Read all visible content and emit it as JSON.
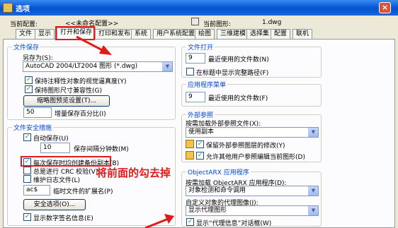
{
  "window": {
    "title": "选项",
    "close_glyph": "×"
  },
  "profile": {
    "current_profile_label": "当前配置:",
    "current_profile_value": "<<未命名配置>>",
    "current_drawing_label": "当前图形:",
    "current_drawing_value": "1.dwg"
  },
  "tabs": [
    "文件",
    "显示",
    "打开和保存",
    "打印和发布",
    "系统",
    "用户系统配置",
    "绘图",
    "三维建模",
    "选择集",
    "配置",
    "联机"
  ],
  "active_tab": "打开和保存",
  "file_save": {
    "title": "文件保存",
    "save_as_label": "另存为(S):",
    "save_as_value": "AutoCAD 2004/LT2004 图形 (*.dwg)",
    "keep_visual_fidelity": "保持注释性对象的视觉逼真度(Y)",
    "keep_drawing_size": "保持图形尺寸兼容性(G)",
    "thumbnail_button": "缩略图预览设置(T)...",
    "incremental_value": "50",
    "incremental_label": "增量保存百分比(I)"
  },
  "file_safety": {
    "title": "文件安全措施",
    "autosave": "自动保存(U)",
    "interval_value": "10",
    "interval_label": "保存间隔分钟数(M)",
    "backup_copy": "每次保存时均创建备份副本(B)",
    "crc_check": "总是进行 CRC 校验(V)",
    "log_file": "维护日志文件(L)",
    "temp_ext_value": "ac$",
    "temp_ext_label": "临时文件的扩展名(P)",
    "security_button": "安全选项(O)...",
    "digital_signature": "显示数字签名信息(E)"
  },
  "file_open": {
    "title": "文件打开",
    "recent_count_value": "9",
    "recent_count_label": "最近使用的文件数(N)",
    "full_path": "在标题中显示完整路径(F)"
  },
  "app_menu": {
    "title": "应用程序菜单",
    "recent_count_value": "9",
    "recent_count_label": "最近使用的文件数(F)"
  },
  "xref": {
    "title": "外部参照",
    "demand_load_label": "按需加载外部参照文件(X):",
    "demand_load_value": "使用副本",
    "retain_layer_changes": "保留外部参照图层的修改(Y)",
    "allow_edit": "允许其他用户参照编辑当前图形(D)"
  },
  "objectarx": {
    "title": "ObjectARX 应用程序",
    "demand_load_label": "按需加载 ObjectARX 应用程序(D):",
    "demand_load_value": "对象检测和命令调用",
    "proxy_objects_label": "自定义对象的代理图像(J):",
    "proxy_objects_value": "显示代理图形",
    "proxy_dialog": "显示“代理信息”对话框(W)"
  },
  "annotation": {
    "text": "将前面的勾去掉"
  },
  "colors": {
    "annotation_red": "#e01b1b",
    "group_title_blue": "#0046d5"
  }
}
